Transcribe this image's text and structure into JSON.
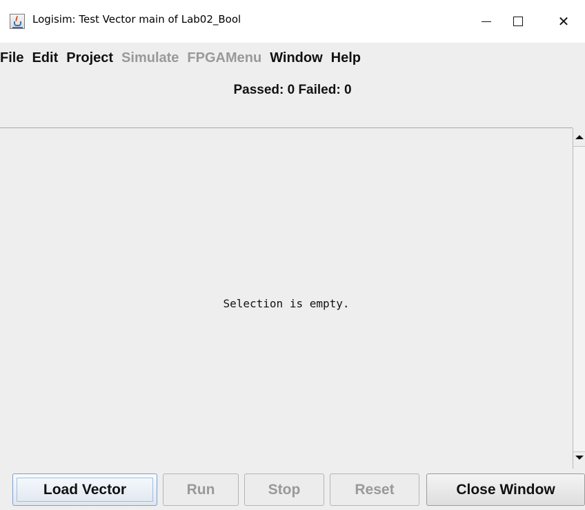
{
  "window": {
    "title": "Logisim: Test Vector main of Lab02_Bool",
    "controls": {
      "minimize_icon": "minimize-icon",
      "maximize_icon": "maximize-icon",
      "close_glyph": "✕"
    }
  },
  "menu": {
    "items": [
      {
        "label": "File",
        "enabled": true
      },
      {
        "label": "Edit",
        "enabled": true
      },
      {
        "label": "Project",
        "enabled": true
      },
      {
        "label": "Simulate",
        "enabled": false
      },
      {
        "label": "FPGAMenu",
        "enabled": false
      },
      {
        "label": "Window",
        "enabled": true
      },
      {
        "label": "Help",
        "enabled": true
      }
    ]
  },
  "status": {
    "text": "Passed: 0 Failed: 0"
  },
  "content": {
    "empty_message": "Selection is empty."
  },
  "buttons": {
    "load_vector": "Load Vector",
    "run": "Run",
    "stop": "Stop",
    "reset": "Reset",
    "close_window": "Close Window"
  },
  "colors": {
    "background": "#eeeeee",
    "disabled_text": "#999999",
    "focus_accent": "#7a9fcf"
  }
}
